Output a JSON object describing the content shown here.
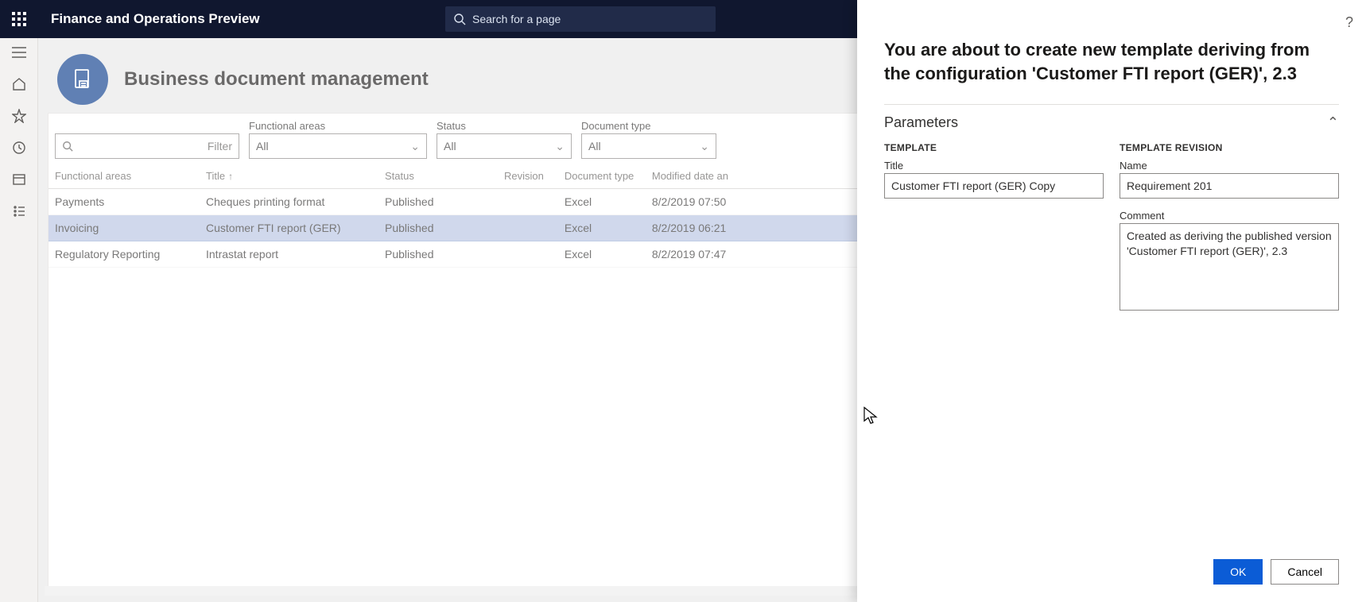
{
  "topbar": {
    "app_title": "Finance and Operations Preview",
    "search_placeholder": "Search for a page"
  },
  "page": {
    "title": "Business document management"
  },
  "filters": {
    "filter_placeholder": "Filter",
    "functional_areas": {
      "label": "Functional areas",
      "value": "All"
    },
    "status": {
      "label": "Status",
      "value": "All"
    },
    "document_type": {
      "label": "Document type",
      "value": "All"
    }
  },
  "columns": {
    "functional_areas": "Functional areas",
    "title": "Title",
    "status": "Status",
    "revision": "Revision",
    "document_type": "Document type",
    "modified": "Modified date an"
  },
  "rows": [
    {
      "functional_areas": "Payments",
      "title": "Cheques printing format",
      "status": "Published",
      "revision": "",
      "document_type": "Excel",
      "modified": "8/2/2019 07:50"
    },
    {
      "functional_areas": "Invoicing",
      "title": "Customer FTI report (GER)",
      "status": "Published",
      "revision": "",
      "document_type": "Excel",
      "modified": "8/2/2019 06:21"
    },
    {
      "functional_areas": "Regulatory Reporting",
      "title": "Intrastat report",
      "status": "Published",
      "revision": "",
      "document_type": "Excel",
      "modified": "8/2/2019 07:47"
    }
  ],
  "selected_row_index": 1,
  "panel": {
    "heading": "You are about to create new template deriving from the configuration 'Customer FTI report (GER)', 2.3",
    "section_label": "Parameters",
    "template_group": "TEMPLATE",
    "revision_group": "TEMPLATE REVISION",
    "title_label": "Title",
    "title_value": "Customer FTI report (GER) Copy",
    "name_label": "Name",
    "name_value": "Requirement 201",
    "comment_label": "Comment",
    "comment_value": "Created as deriving the published version 'Customer FTI report (GER)', 2.3",
    "ok_label": "OK",
    "cancel_label": "Cancel"
  }
}
